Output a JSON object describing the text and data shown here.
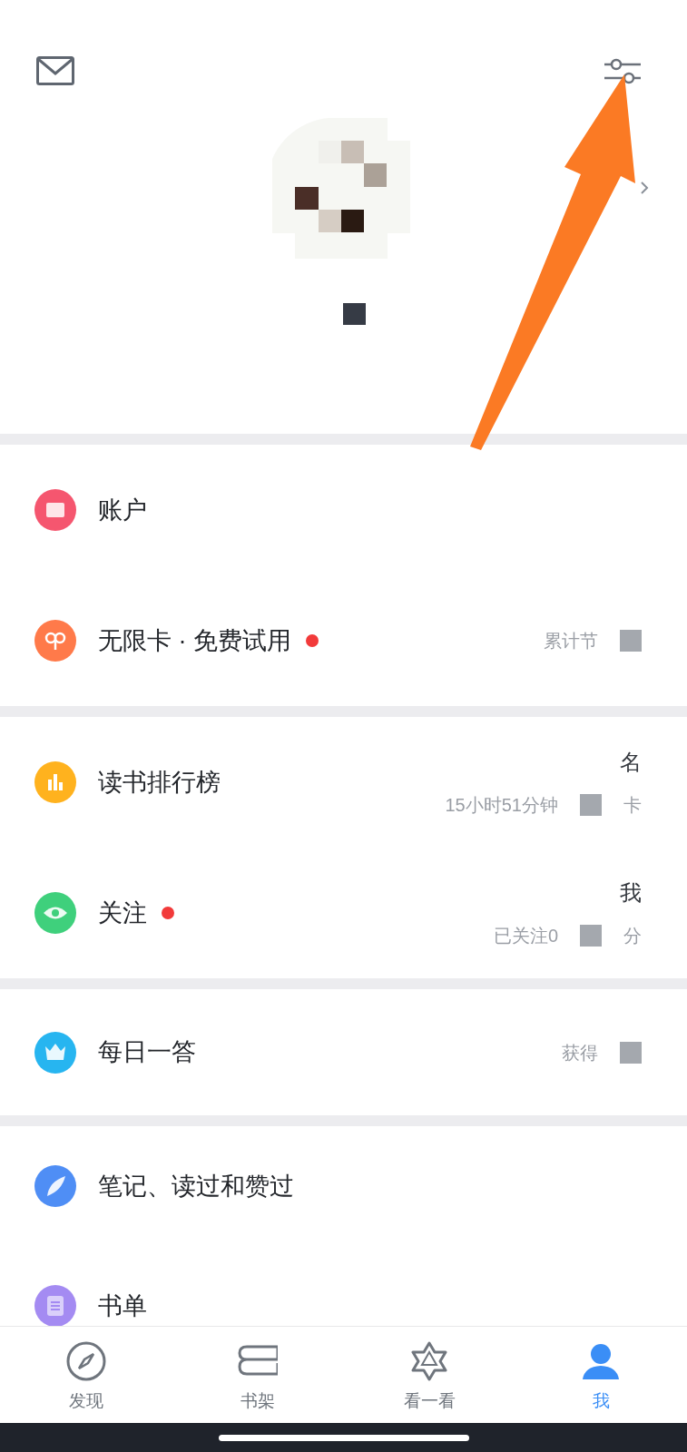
{
  "sections": [
    {
      "rows": [
        {
          "label": "账户",
          "color": "#f5566f",
          "badge": false,
          "top_fragment": "",
          "subtext": "",
          "sub_fragment": ""
        },
        {
          "label": "无限卡 · 免费试用",
          "color": "#ff7a4a",
          "badge": true,
          "top_fragment": "",
          "subtext": "累计节",
          "sub_fragment": ""
        }
      ]
    },
    {
      "rows": [
        {
          "label": "读书排行榜",
          "color": "#ffb21e",
          "badge": false,
          "top_fragment": "名",
          "subtext": "15小时51分钟",
          "sub_fragment": "卡"
        },
        {
          "label": "关注",
          "color": "#3fd07c",
          "badge": true,
          "top_fragment": "我",
          "subtext": "已关注0",
          "sub_fragment": "分"
        }
      ]
    },
    {
      "rows": [
        {
          "label": "每日一答",
          "color": "#27b5f0",
          "badge": false,
          "top_fragment": "",
          "subtext": "获得",
          "sub_fragment": ""
        }
      ]
    },
    {
      "rows": [
        {
          "label": "笔记、读过和赞过",
          "color": "#4f8ef5",
          "badge": false,
          "top_fragment": "",
          "subtext": "",
          "sub_fragment": ""
        },
        {
          "label": "书单",
          "color": "#a48bf2",
          "badge": false,
          "top_fragment": "",
          "subtext": "",
          "sub_fragment": ""
        }
      ]
    }
  ],
  "tabs": [
    {
      "label": "发现",
      "selected": false
    },
    {
      "label": "书架",
      "selected": false
    },
    {
      "label": "看一看",
      "selected": false
    },
    {
      "label": "我",
      "selected": true
    }
  ]
}
